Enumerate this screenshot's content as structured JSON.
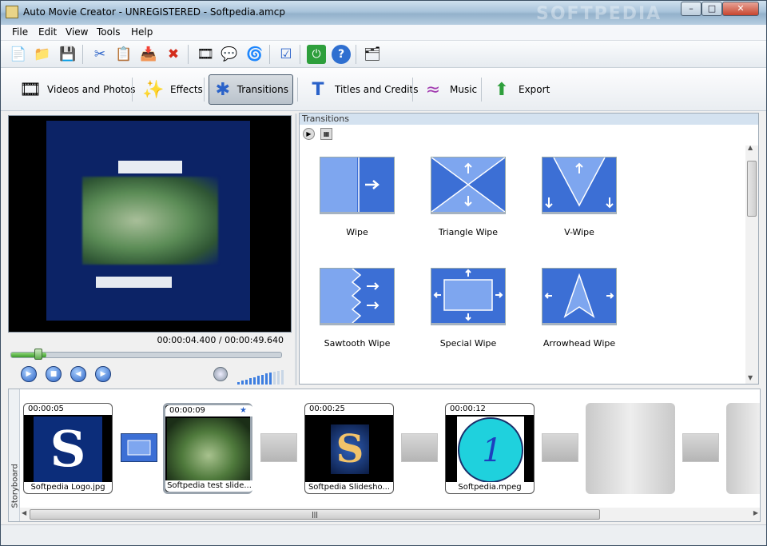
{
  "window": {
    "title": "Auto Movie Creator - UNREGISTERED   - Softpedia.amcp",
    "watermark": "SOFTPEDIA",
    "min": "–",
    "max": "□",
    "close": "✕"
  },
  "menu": [
    "File",
    "Edit",
    "View",
    "Tools",
    "Help"
  ],
  "toolbar": {
    "icons": [
      "📄",
      "📁",
      "💾",
      "✂",
      "📋",
      "📥",
      "✖",
      "🎞",
      "💬",
      "🌀",
      "☑",
      "⏻",
      "?",
      "🗂"
    ]
  },
  "nav": {
    "videos": "Videos and Photos",
    "effects": "Effects",
    "transitions": "Transitions",
    "titles": "Titles and Credits",
    "music": "Music",
    "export": "Export"
  },
  "player": {
    "timecode": "00:00:04.400 / 00:00:49.640",
    "progress": 0.13
  },
  "transitions_panel": {
    "header": "Transitions",
    "items": [
      {
        "label": "Wipe",
        "icon": "→"
      },
      {
        "label": "Triangle Wipe",
        "icon": "✕"
      },
      {
        "label": "V-Wipe",
        "icon": "V"
      },
      {
        "label": "Sawtooth Wipe",
        "icon": "≋"
      },
      {
        "label": "Special Wipe",
        "icon": "▭"
      },
      {
        "label": "Arrowhead Wipe",
        "icon": "▲"
      }
    ]
  },
  "storyboard": {
    "label": "Storyboard",
    "clips": [
      {
        "time": "00:00:05",
        "name": "Softpedia Logo.jpg"
      },
      {
        "time": "00:00:09",
        "name": "Softpedia test slide..."
      },
      {
        "time": "00:00:25",
        "name": "Softpedia Slidesho..."
      },
      {
        "time": "00:00:12",
        "name": "Softpedia.mpeg"
      }
    ]
  }
}
